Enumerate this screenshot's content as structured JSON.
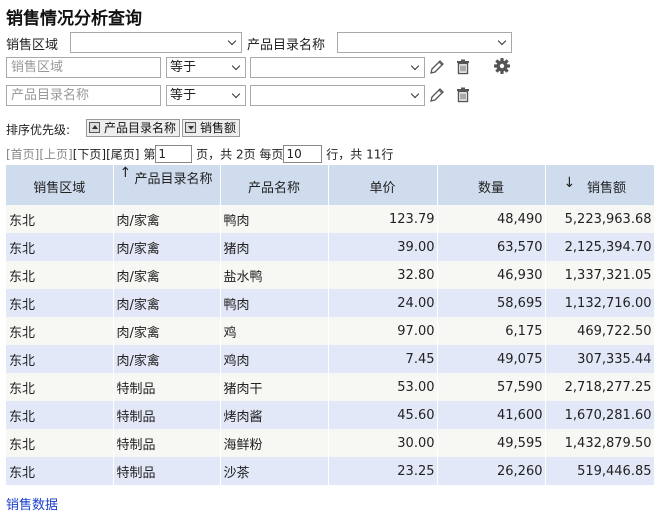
{
  "page_title": "销售情况分析查询",
  "filters": {
    "region_label": "销售区域",
    "region_value": "",
    "category_label": "产品目录名称",
    "category_value": "",
    "rows": [
      {
        "field_placeholder": "销售区域",
        "operator": "等于",
        "value": ""
      },
      {
        "field_placeholder": "产品目录名称",
        "operator": "等于",
        "value": ""
      }
    ]
  },
  "icons": {
    "edit": "pencil-icon",
    "delete": "trash-icon",
    "settings": "gear-icon"
  },
  "sort": {
    "label": "排序优先级:",
    "items": [
      {
        "label": "产品目录名称",
        "direction": "asc"
      },
      {
        "label": "销售额",
        "direction": "desc"
      }
    ]
  },
  "pager": {
    "first": "[首页]",
    "prev": "[上页]",
    "next": "[下页]",
    "last": "[尾页]",
    "page_prefix": "第",
    "current_page": "1",
    "page_suffix": "页，共 2页 每页",
    "page_size": "10",
    "total_suffix": "行，共 11行"
  },
  "table": {
    "columns": [
      {
        "label": "销售区域",
        "sort_arrow": ""
      },
      {
        "label": "产品目录名称",
        "sort_arrow": "↑"
      },
      {
        "label": "产品名称",
        "sort_arrow": ""
      },
      {
        "label": "单价",
        "sort_arrow": ""
      },
      {
        "label": "数量",
        "sort_arrow": ""
      },
      {
        "label": "销售额",
        "sort_arrow": "↓"
      }
    ],
    "rows": [
      [
        "东北",
        "肉/家禽",
        "鸭肉",
        "123.79",
        "48,490",
        "5,223,963.68"
      ],
      [
        "东北",
        "肉/家禽",
        "猪肉",
        "39.00",
        "63,570",
        "2,125,394.70"
      ],
      [
        "东北",
        "肉/家禽",
        "盐水鸭",
        "32.80",
        "46,930",
        "1,337,321.05"
      ],
      [
        "东北",
        "肉/家禽",
        "鸭肉",
        "24.00",
        "58,695",
        "1,132,716.00"
      ],
      [
        "东北",
        "肉/家禽",
        "鸡",
        "97.00",
        "6,175",
        "469,722.50"
      ],
      [
        "东北",
        "肉/家禽",
        "鸡肉",
        "7.45",
        "49,075",
        "307,335.44"
      ],
      [
        "东北",
        "特制品",
        "猪肉干",
        "53.00",
        "57,590",
        "2,718,277.25"
      ],
      [
        "东北",
        "特制品",
        "烤肉酱",
        "45.60",
        "41,600",
        "1,670,281.60"
      ],
      [
        "东北",
        "特制品",
        "海鲜粉",
        "30.00",
        "49,595",
        "1,432,879.50"
      ],
      [
        "东北",
        "特制品",
        "沙茶",
        "23.25",
        "26,260",
        "519,446.85"
      ]
    ]
  },
  "footer_link": "销售数据"
}
